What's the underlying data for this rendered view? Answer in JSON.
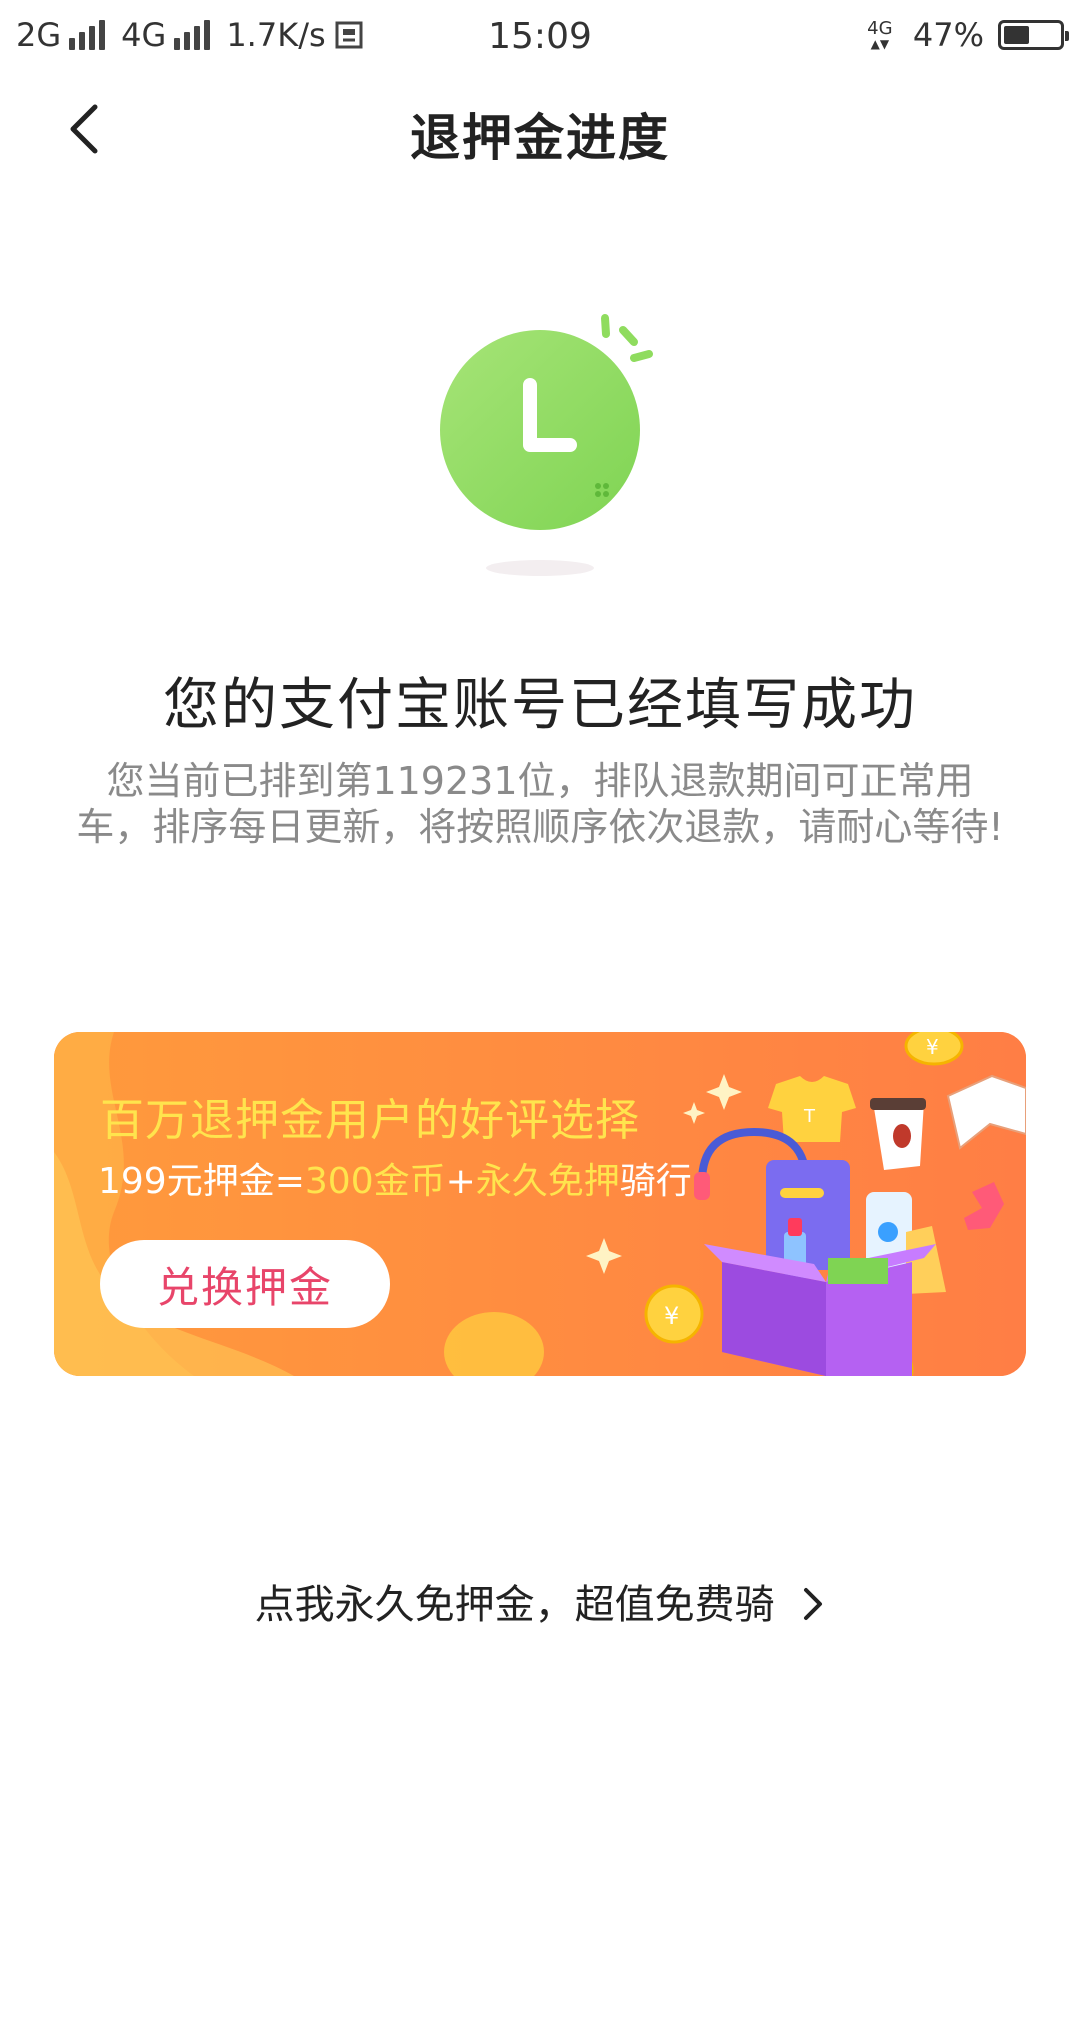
{
  "status_bar": {
    "sim1": "2G",
    "sim2": "4G",
    "speed": "1.7K/s",
    "extra_icon": "screenshot-icon",
    "time": "15:09",
    "network_badge": "4G",
    "battery_percent": "47%",
    "battery_level": 0.47
  },
  "nav": {
    "back_icon": "chevron-left-icon",
    "title": "退押金进度"
  },
  "illustration": {
    "icon": "clock-icon",
    "color": "#8fdc5e"
  },
  "main": {
    "title": "您的支付宝账号已经填写成功",
    "queue_text": "您当前已排到第119231位，排队退款期间可正常用车，排序每日更新，将按照顺序依次退款，请耐心等待!"
  },
  "banner": {
    "headline": "百万退押金用户的好评选择",
    "sub_part1": "199元押金=",
    "sub_part2": "300金币",
    "sub_part3": "+",
    "sub_part4": "永久免押",
    "sub_part5": "骑行",
    "button_label": "兑换押金",
    "accent_color": "#ffe44d",
    "button_text_color": "#e8456a",
    "background_color": "#ff8a3d"
  },
  "footer_link": {
    "label": "点我永久免押金，超值免费骑",
    "icon": "chevron-right-icon"
  }
}
